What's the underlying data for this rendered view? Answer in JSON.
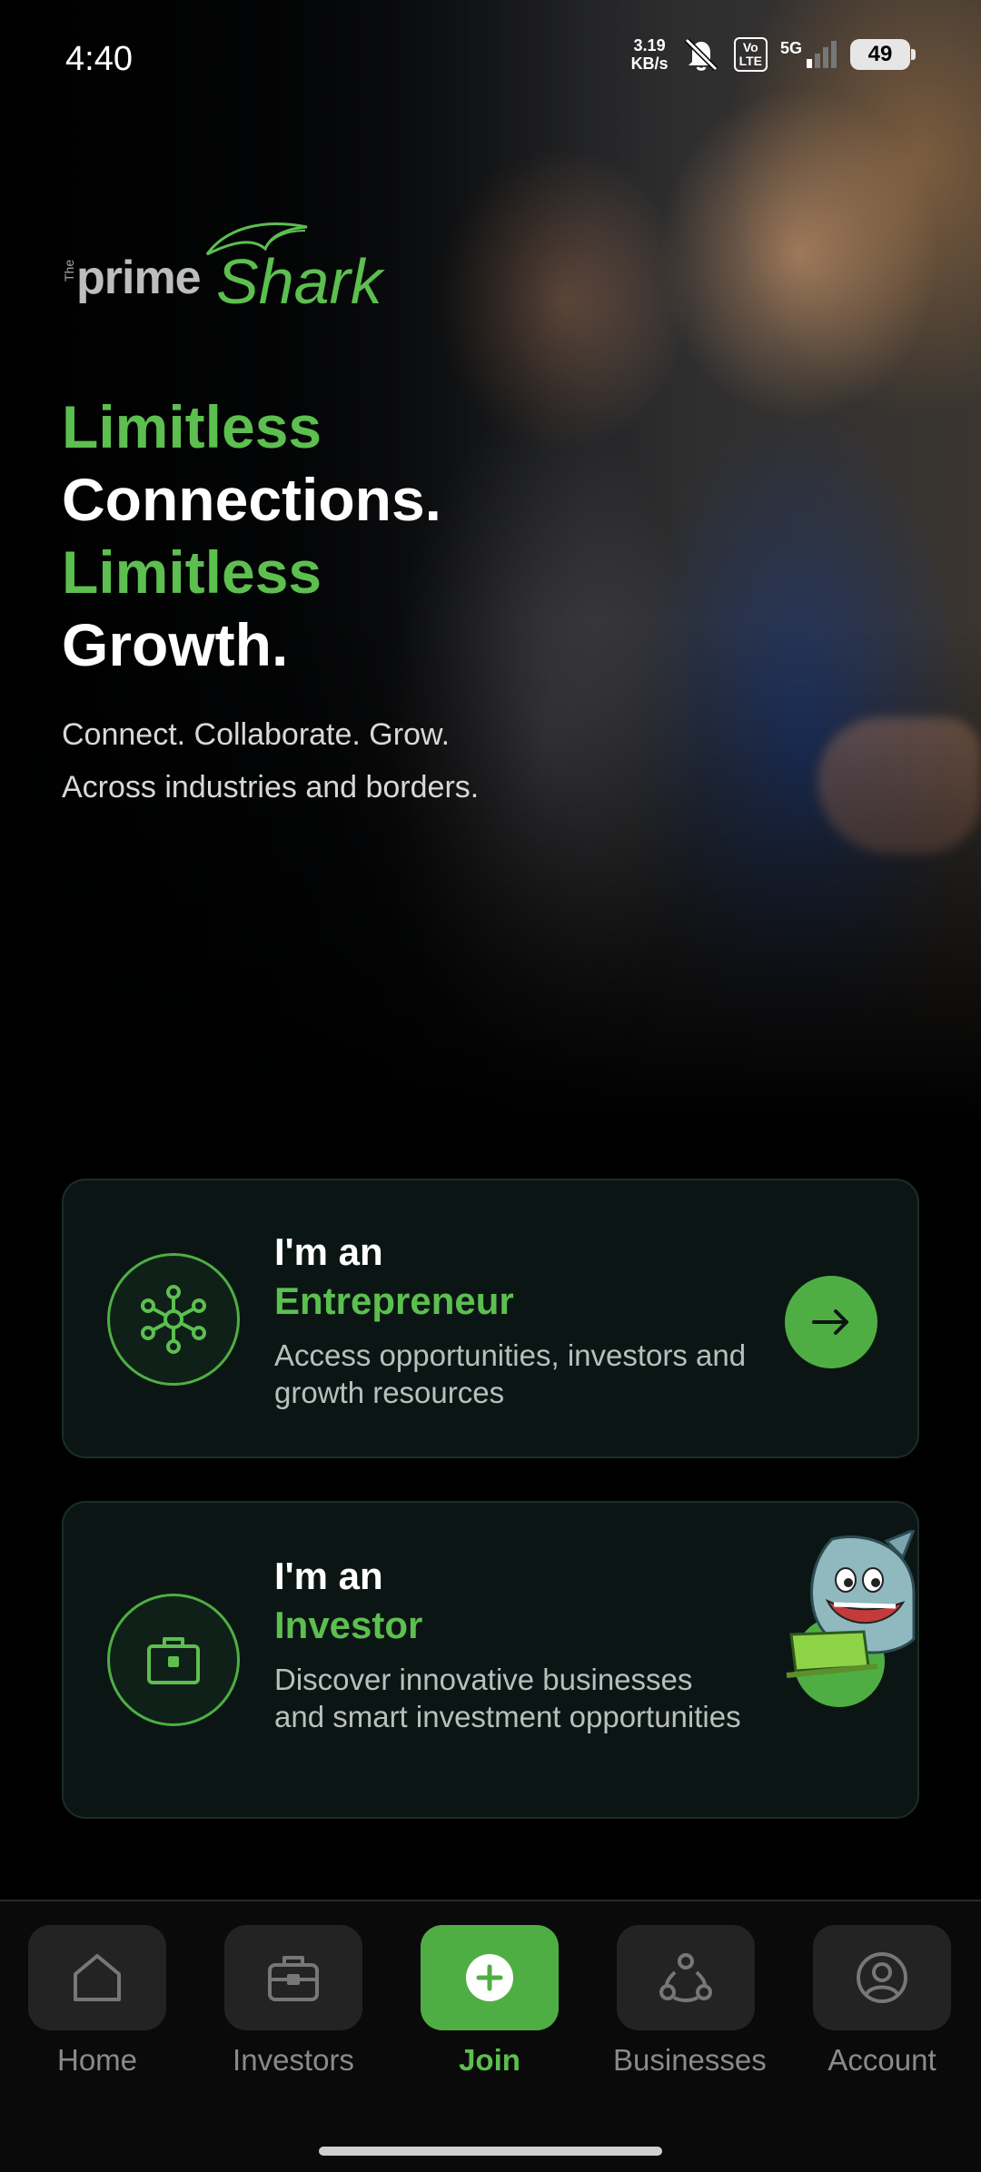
{
  "status_bar": {
    "time": "4:40",
    "net_speed_value": "3.19",
    "net_speed_unit": "KB/s",
    "volte": "Vo\nLTE",
    "network": "5G",
    "battery": "49",
    "icons": [
      "mute-icon",
      "signal-icon",
      "battery-icon"
    ]
  },
  "logo": {
    "prefix": "The",
    "part1": "prime",
    "part2": "Shark"
  },
  "hero": {
    "line1": "Limitless",
    "line2": "Connections.",
    "line3": "Limitless",
    "line4": "Growth.",
    "tagline1": "Connect. Collaborate. Grow.",
    "tagline2": "Across industries and borders."
  },
  "cards": [
    {
      "title_prefix": "I'm an",
      "title_role": "Entrepreneur",
      "description": "Access opportunities, investors and growth resources",
      "icon": "network-hub-icon",
      "action_icon": "arrow-right-icon"
    },
    {
      "title_prefix": "I'm an",
      "title_role": "Investor",
      "description": "Discover innovative businesses and smart investment opportunities",
      "icon": "briefcase-icon",
      "action_icon": "shark-mascot"
    }
  ],
  "nav": {
    "items": [
      {
        "label": "Home",
        "icon": "home-icon"
      },
      {
        "label": "Investors",
        "icon": "briefcase-icon"
      },
      {
        "label": "Join",
        "icon": "plus-circle-icon",
        "active": true
      },
      {
        "label": "Businesses",
        "icon": "share-nodes-icon"
      },
      {
        "label": "Account",
        "icon": "user-circle-icon"
      }
    ]
  },
  "colors": {
    "accent": "#5cbf4f",
    "card_bg": "#0b1614",
    "nav_bg": "#0a0a0a"
  }
}
